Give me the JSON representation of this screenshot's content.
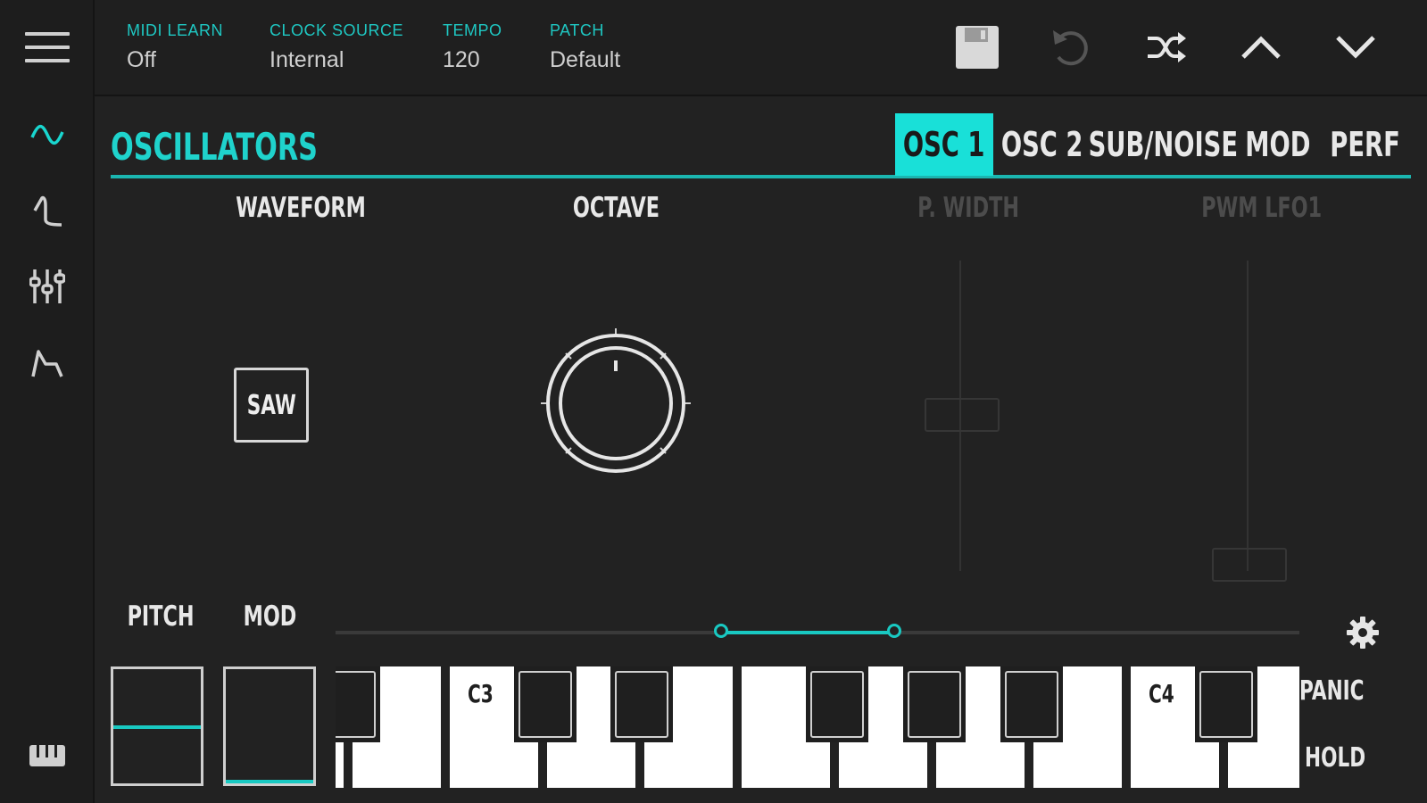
{
  "topbar": {
    "midi_learn": {
      "label": "MIDI LEARN",
      "value": "Off"
    },
    "clock_source": {
      "label": "CLOCK SOURCE",
      "value": "Internal"
    },
    "tempo": {
      "label": "TEMPO",
      "value": "120"
    },
    "patch": {
      "label": "PATCH",
      "value": "Default"
    }
  },
  "section": {
    "title": "OSCILLATORS"
  },
  "tabs": [
    {
      "label": "OSC 1",
      "active": true
    },
    {
      "label": "OSC 2",
      "active": false
    },
    {
      "label": "SUB/NOISE",
      "active": false
    },
    {
      "label": "MOD",
      "active": false
    },
    {
      "label": "PERF",
      "active": false
    }
  ],
  "params": {
    "waveform": {
      "label": "WAVEFORM",
      "value": "SAW"
    },
    "octave": {
      "label": "OCTAVE"
    },
    "pulse_width": {
      "label": "P. WIDTH"
    },
    "pwm_lfo1": {
      "label": "PWM LFO1"
    }
  },
  "performance": {
    "pitch_label": "PITCH",
    "mod_label": "MOD",
    "panic_label": "PANIC",
    "hold_label": "HOLD"
  },
  "keyboard": {
    "c3_label": "C3",
    "c4_label": "C4"
  },
  "colors": {
    "accent": "#19e0d8",
    "background": "#222222",
    "text": "#e8e8e8"
  },
  "icons": [
    "menu-icon",
    "oscillator-wave-icon",
    "filter-icon",
    "mixer-icon",
    "envelope-icon",
    "keyboard-toggle-icon",
    "save-icon",
    "undo-icon",
    "shuffle-icon",
    "chevron-up-icon",
    "chevron-down-icon",
    "settings-gear-icon"
  ]
}
